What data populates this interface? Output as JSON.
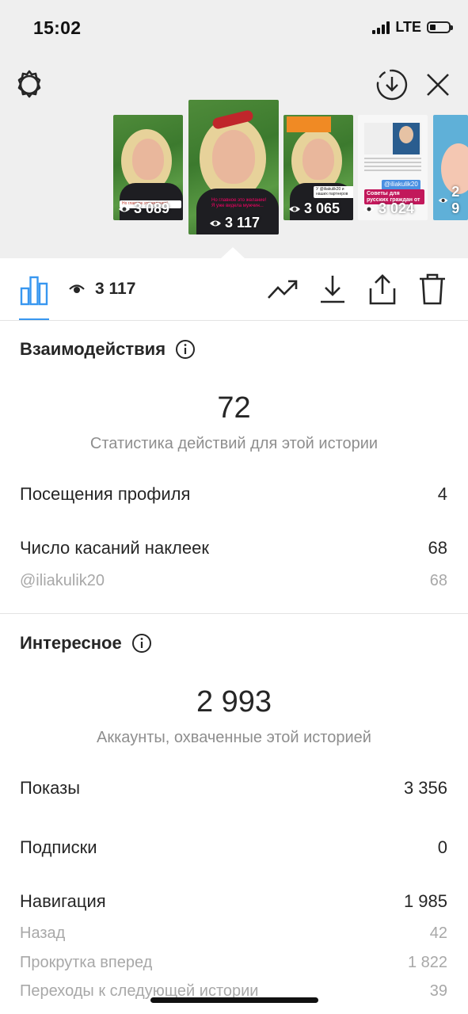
{
  "status_bar": {
    "time": "15:02",
    "network": "LTE"
  },
  "stories": [
    {
      "views": "3 089",
      "caption": "Но главное это желание!"
    },
    {
      "views": "3 117",
      "caption": "Но главное это желание! Я уже видела мужчин..."
    },
    {
      "views": "3 065",
      "caption": "У @iliakulik20 и наших партнеров"
    },
    {
      "views": "3 024",
      "mention": "@iliakulik20",
      "banner": "Советы для русских граждан от"
    },
    {
      "views": "2 9"
    }
  ],
  "toolbar": {
    "views_count": "3 117"
  },
  "interactions": {
    "title": "Взаимодействия",
    "total": "72",
    "total_label": "Статистика действий для этой истории",
    "rows": [
      {
        "label": "Посещения профиля",
        "value": "4"
      },
      {
        "label": "Число касаний наклеек",
        "value": "68"
      }
    ],
    "sub_rows": [
      {
        "label": "@iliakulik20",
        "value": "68"
      }
    ]
  },
  "discovery": {
    "title": "Интересное",
    "total": "2 993",
    "total_label": "Аккаунты, охваченные этой историей",
    "rows": [
      {
        "label": "Показы",
        "value": "3 356"
      },
      {
        "label": "Подписки",
        "value": "0"
      },
      {
        "label": "Навигация",
        "value": "1 985"
      }
    ],
    "nav_rows": [
      {
        "label": "Назад",
        "value": "42"
      },
      {
        "label": "Прокрутка вперед",
        "value": "1 822"
      },
      {
        "label": "Переходы к следующей истории",
        "value": "39"
      }
    ]
  },
  "colors": {
    "accent": "#3897f0",
    "text": "#262626",
    "muted": "#8e8e8e",
    "top_bg": "#efefef"
  }
}
